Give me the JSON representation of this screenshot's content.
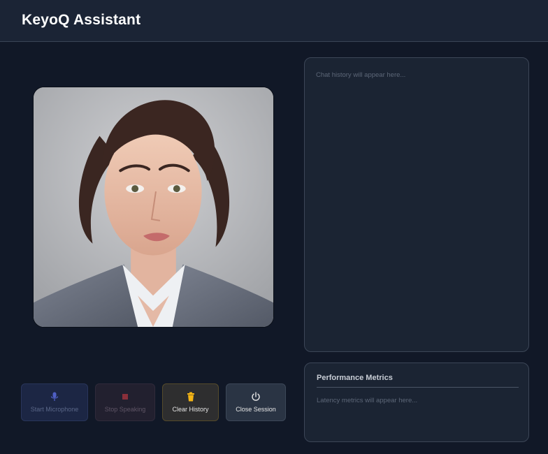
{
  "header": {
    "title": "KeyoQ Assistant"
  },
  "avatar": {
    "icon": "portrait-avatar"
  },
  "controls": {
    "start_microphone": {
      "label": "Start Microphone",
      "icon": "microphone-icon",
      "color": "#4f5fc4"
    },
    "stop_speaking": {
      "label": "Stop Speaking",
      "icon": "stop-icon",
      "color": "#8a2f3a"
    },
    "clear_history": {
      "label": "Clear History",
      "icon": "trash-icon",
      "color": "#f5b515"
    },
    "close_session": {
      "label": "Close Session",
      "icon": "power-icon",
      "color": "#e6e6e6"
    }
  },
  "chat": {
    "placeholder": "Chat history will appear here..."
  },
  "metrics": {
    "title": "Performance Metrics",
    "placeholder": "Latency metrics will appear here..."
  },
  "colors": {
    "background": "#111827",
    "header": "#1b2435",
    "panel": "#1b2433"
  }
}
